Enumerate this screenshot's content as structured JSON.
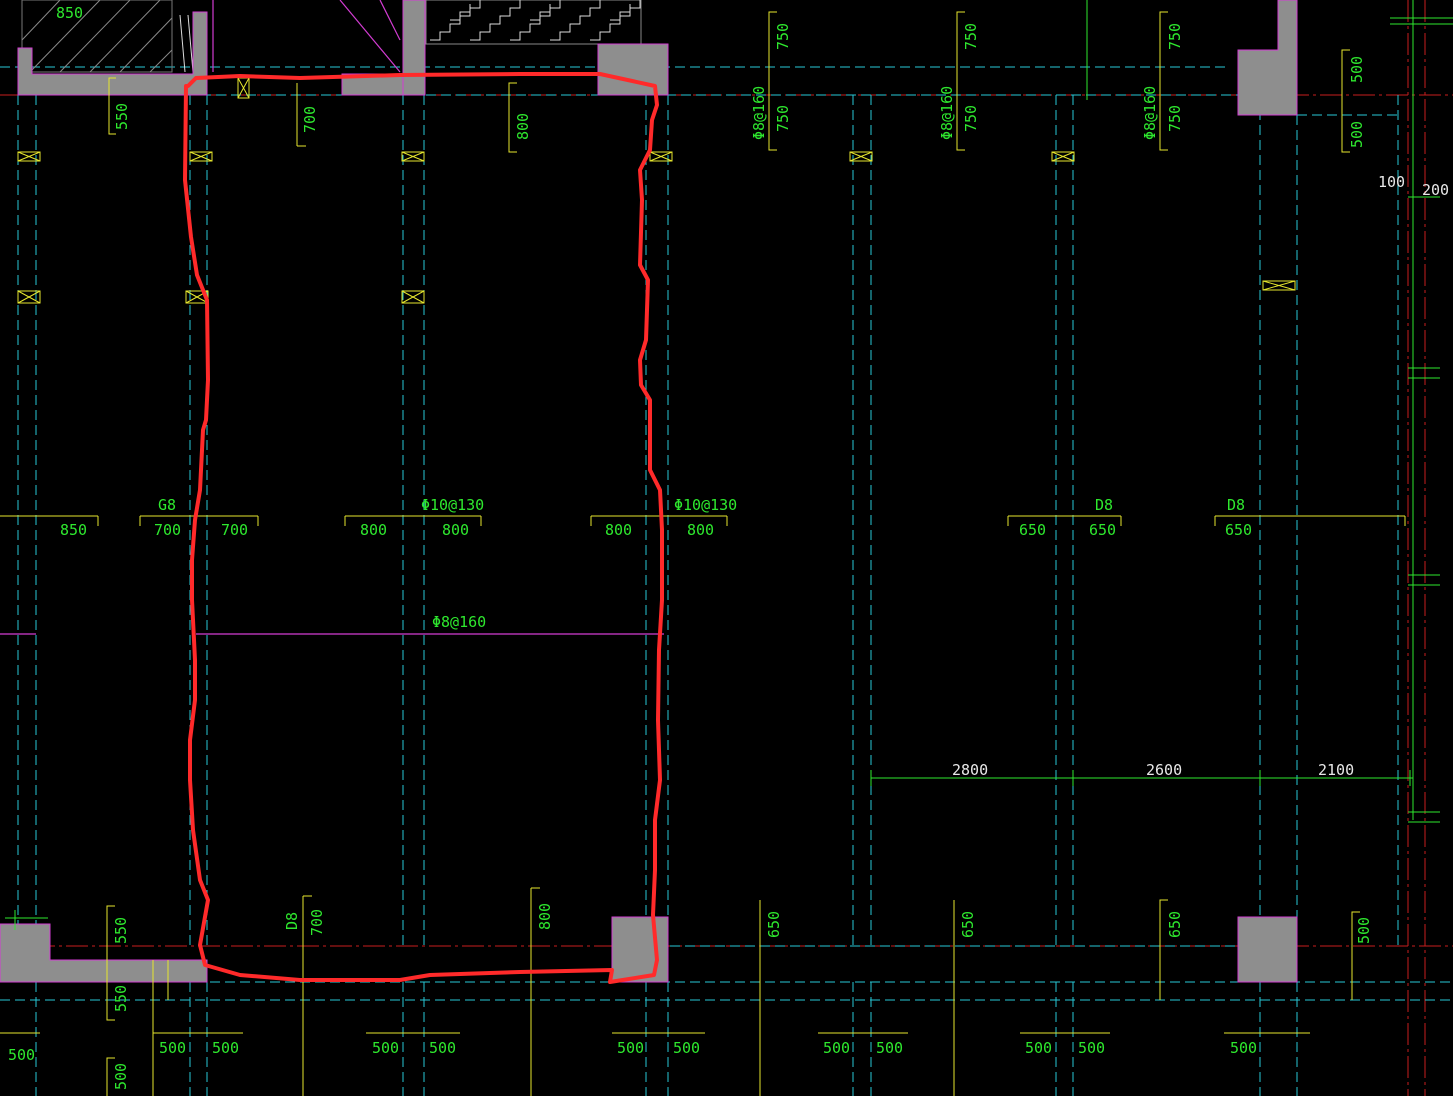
{
  "drawing": {
    "top_left_dim": "850",
    "top_dims_vertical": [
      "550",
      "700",
      "800"
    ],
    "top_rebar": [
      {
        "spec": "Φ8@160",
        "upper": "750",
        "lower": "750"
      },
      {
        "spec": "Φ8@160",
        "upper": "750",
        "lower": "750"
      },
      {
        "spec": "Φ8@160",
        "upper": "750",
        "lower": "750"
      }
    ],
    "right_top_dims": [
      "500",
      "500"
    ],
    "right_small_dims": [
      "100",
      "200"
    ],
    "mid_labels": {
      "g8": "G8",
      "phi10_a": "Φ10@130",
      "phi10_b": "Φ10@130",
      "d8_a": "D8",
      "d8_b": "D8"
    },
    "mid_dims": [
      "850",
      "700",
      "700",
      "800",
      "800",
      "800",
      "800",
      "650",
      "650",
      "650"
    ],
    "span_rebar": "Φ8@160",
    "spans": [
      "2800",
      "2600",
      "2100"
    ],
    "bottom_vertical": {
      "d8": "D8",
      "values": [
        "550",
        "700",
        "800",
        "650",
        "650",
        "650",
        "500",
        "550",
        "500"
      ]
    },
    "bottom_dims": [
      "500",
      "500",
      "500",
      "500",
      "500",
      "500",
      "500",
      "500",
      "500",
      "500",
      "500",
      "500"
    ],
    "colors": {
      "background": "#000000",
      "gridline": "#29c7d6",
      "axis": "#c81e1e",
      "dimension_line": "#e6e62e",
      "dimension_text": "#2ee82e",
      "wall": "#8e8e8e",
      "markup": "#ff2a2a",
      "rebar_line": "#d23cd2"
    }
  }
}
